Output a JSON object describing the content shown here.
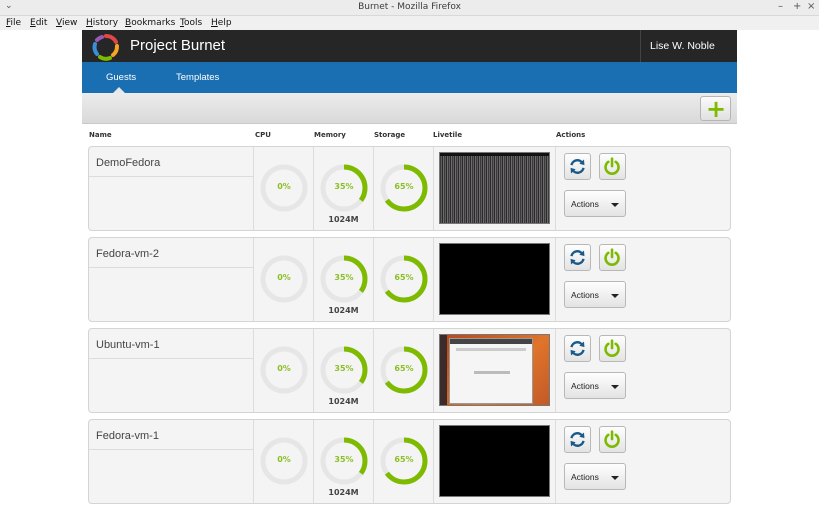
{
  "window": {
    "title": "Burnet - Mozilla Firefox",
    "menu": [
      {
        "label": "File",
        "u": "F",
        "rest": "ile"
      },
      {
        "label": "Edit",
        "u": "E",
        "rest": "dit"
      },
      {
        "label": "View",
        "u": "V",
        "rest": "iew"
      },
      {
        "label": "History",
        "u": "H",
        "rest": "istory"
      },
      {
        "label": "Bookmarks",
        "u": "B",
        "rest": "ookmarks"
      },
      {
        "label": "Tools",
        "u": "T",
        "rest": "ools"
      },
      {
        "label": "Help",
        "u": "H",
        "rest": "elp"
      }
    ]
  },
  "app": {
    "title": "Project Burnet",
    "user": "Lise W. Noble",
    "tabs": [
      {
        "label": "Guests",
        "active": true
      },
      {
        "label": "Templates",
        "active": false
      }
    ],
    "add_icon": "plus-icon"
  },
  "columns": {
    "name": "Name",
    "cpu": "CPU",
    "memory": "Memory",
    "storage": "Storage",
    "livetile": "Livetile",
    "actions": "Actions"
  },
  "colors": {
    "accent_green": "#7dba00",
    "nav_blue": "#1a6fb3",
    "header_dark": "#262626"
  },
  "guests": [
    {
      "name": "DemoFedora",
      "cpu": "0%",
      "cpu_value": 0,
      "memory": "35%",
      "memory_value": 35,
      "memory_size": "1024M",
      "storage": "65%",
      "storage_value": 65,
      "livetile": "fedora-console",
      "actions_label": "Actions"
    },
    {
      "name": "Fedora-vm-2",
      "cpu": "0%",
      "cpu_value": 0,
      "memory": "35%",
      "memory_value": 35,
      "memory_size": "1024M",
      "storage": "65%",
      "storage_value": 65,
      "livetile": "blank",
      "actions_label": "Actions"
    },
    {
      "name": "Ubuntu-vm-1",
      "cpu": "0%",
      "cpu_value": 0,
      "memory": "35%",
      "memory_value": 35,
      "memory_size": "1024M",
      "storage": "65%",
      "storage_value": 65,
      "livetile": "ubuntu-desktop",
      "actions_label": "Actions"
    },
    {
      "name": "Fedora-vm-1",
      "cpu": "0%",
      "cpu_value": 0,
      "memory": "35%",
      "memory_value": 35,
      "memory_size": "1024M",
      "storage": "65%",
      "storage_value": 65,
      "livetile": "blank",
      "actions_label": "Actions"
    }
  ]
}
